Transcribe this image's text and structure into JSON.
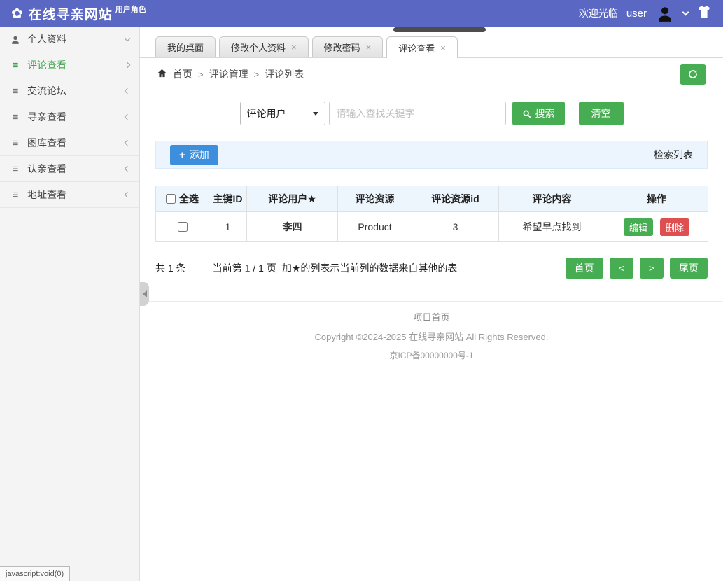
{
  "colors": {
    "header_bg": "#5a67c3",
    "green": "#47ad53",
    "blue": "#3d8fdd",
    "red": "#d9302c",
    "table_header_bg": "#eef6fd",
    "toolbar_bg": "#ecf5fd"
  },
  "icons": {
    "flower": "✿",
    "menu": "≡",
    "close": "×",
    "plus": "+"
  },
  "header": {
    "title": "在线寻亲网站",
    "role": "用户角色",
    "welcome": "欢迎光临",
    "username": "user"
  },
  "sidebar": {
    "items": [
      {
        "label": "个人资料",
        "state": "expanded"
      },
      {
        "label": "评论查看",
        "state": "active"
      },
      {
        "label": "交流论坛",
        "state": "collapsed"
      },
      {
        "label": "寻亲查看",
        "state": "collapsed"
      },
      {
        "label": "图库查看",
        "state": "collapsed"
      },
      {
        "label": "认亲查看",
        "state": "collapsed"
      },
      {
        "label": "地址查看",
        "state": "collapsed"
      }
    ]
  },
  "tabs": [
    {
      "label": "我的桌面",
      "closable": false,
      "active": false
    },
    {
      "label": "修改个人资料",
      "closable": true,
      "active": false
    },
    {
      "label": "修改密码",
      "closable": true,
      "active": false
    },
    {
      "label": "评论查看",
      "closable": true,
      "active": true
    }
  ],
  "breadcrumb": {
    "home": "首页",
    "sep": ">",
    "items": [
      "评论管理",
      "评论列表"
    ]
  },
  "search": {
    "field_selected": "评论用户",
    "placeholder": "请输入查找关键字",
    "search_label": "搜索",
    "clear_label": "清空"
  },
  "toolbar": {
    "add_label": "添加",
    "right_label": "检索列表"
  },
  "table": {
    "headers": [
      "全选",
      "主键ID",
      "评论用户★",
      "评论资源",
      "评论资源id",
      "评论内容",
      "操作"
    ],
    "rows": [
      {
        "id": "1",
        "user": "李四",
        "resource": "Product",
        "resource_id": "3",
        "content": "希望早点找到"
      }
    ],
    "actions": {
      "edit": "编辑",
      "delete": "删除"
    }
  },
  "pagination": {
    "summary": "共 1 条",
    "current_prefix": "当前第",
    "current_page": "1",
    "current_suffix": "/ 1 页",
    "note": "加★的列表示当前列的数据来自其他的表",
    "first": "首页",
    "prev": "<",
    "next": ">",
    "last": "尾页"
  },
  "footer": {
    "home_link": "项目首页",
    "copyright": "Copyright ©2024-2025 在线寻亲网站 All Rights Reserved.",
    "icp": "京ICP备00000000号-1"
  },
  "statusbar": {
    "text": "javascript:void(0)"
  }
}
